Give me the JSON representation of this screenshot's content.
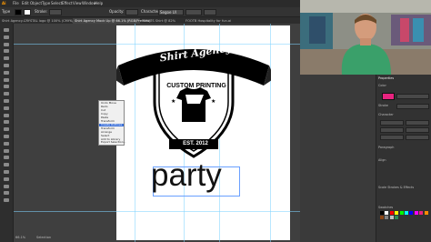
{
  "menubar": {
    "items": [
      "Ai",
      "File",
      "Edit",
      "Object",
      "Type",
      "Select",
      "Effect",
      "View",
      "Window",
      "Help"
    ]
  },
  "controlbar": {
    "selection_label": "Type",
    "stroke_label": "Stroke:",
    "opacity_label": "Opacity:",
    "font_name": "Segoe UI",
    "character_label": "Character:"
  },
  "doctabs": [
    "Shirt Agency...",
    "CRYSTAL logo @ 100% (CMYK/Preview)",
    "Shirt Agency Mock Up @ 66.1% (RGB/Preview)",
    "TCEXTS Shirt @ 82%",
    "FOOTB Hospitality for fun.ai"
  ],
  "logo": {
    "banner_text": "Shirt Agency",
    "subtitle": "CUSTOM PRINTING",
    "est": "EST. 2012"
  },
  "party_text": "party",
  "context_menu": [
    "Undo Move",
    "Redo",
    "Cut",
    "Copy",
    "Paste",
    "Transform",
    "Create Outlines",
    "Transform",
    "Arrange",
    "Select",
    "Add to Library",
    "Export Selection..."
  ],
  "right_panel": {
    "title": "Properties",
    "color_label": "Color",
    "stroke_label": "Stroke",
    "character_label": "Character",
    "paragraph_label": "Paragraph",
    "align_label": "Align",
    "scale_strokes": "Scale Strokes & Effects",
    "swatches_label": "Swatches",
    "fill_color": "#e8237f",
    "stroke_value": "1 pt",
    "swatch_colors": [
      "#000000",
      "#ffffff",
      "#ff0000",
      "#ffff00",
      "#00ff00",
      "#00ffff",
      "#0000ff",
      "#ff00ff",
      "#e8237f",
      "#ff8c00",
      "#8b4513",
      "#808080",
      "#c0c0c0",
      "#2e8b57"
    ]
  },
  "status": {
    "zoom": "66.1%",
    "tool": "Selection"
  },
  "icons": {
    "tools": [
      "selection-icon",
      "direct-selection-icon",
      "pen-icon",
      "type-icon",
      "line-icon",
      "rectangle-icon",
      "paintbrush-icon",
      "pencil-icon",
      "eraser-icon",
      "rotate-icon",
      "scale-icon",
      "width-icon",
      "free-transform-icon",
      "shape-builder-icon",
      "perspective-icon",
      "mesh-icon",
      "gradient-icon",
      "eyedropper-icon",
      "blend-icon",
      "symbol-sprayer-icon",
      "graph-icon",
      "artboard-icon",
      "slice-icon",
      "hand-icon",
      "zoom-icon"
    ]
  }
}
